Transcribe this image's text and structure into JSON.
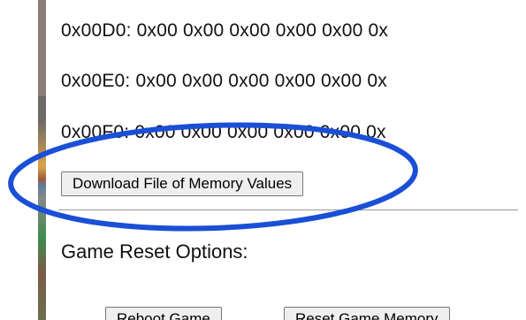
{
  "memory_dump": {
    "rows": [
      "0x00D0: 0x00 0x00 0x00 0x00 0x00 0x",
      "0x00E0: 0x00 0x00 0x00 0x00 0x00 0x",
      "0x00F0: 0x00 0x00 0x00 0x00 0x00 0x"
    ]
  },
  "download_button": {
    "label": "Download File of Memory Values"
  },
  "reset_section": {
    "heading": "Game Reset Options:",
    "reboot_label": "Reboot Game",
    "reset_memory_label": "Reset Game Memory"
  },
  "annotation": {
    "shape": "ellipse",
    "color": "#1a4fd6"
  }
}
